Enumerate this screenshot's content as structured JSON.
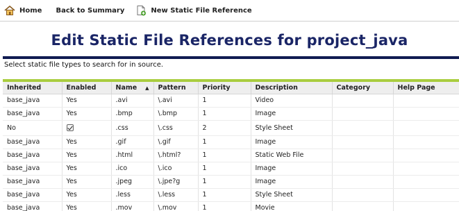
{
  "toolbar": {
    "home_label": "Home",
    "back_label": "Back to Summary",
    "new_label": "New Static File Reference"
  },
  "page": {
    "title": "Edit Static File References for project_java",
    "instructions": "Select static file types to search for in source."
  },
  "colors": {
    "title": "#1a2566",
    "title_rule": "#101c52",
    "table_accent": "#a9cd3f"
  },
  "table": {
    "headers": {
      "inherited": "Inherited",
      "enabled": "Enabled",
      "name": "Name",
      "pattern": "Pattern",
      "priority": "Priority",
      "description": "Description",
      "category": "Category",
      "help_page": "Help Page"
    },
    "sort_indicator": "▲",
    "rows": [
      {
        "inherited": "base_java",
        "enabled": "Yes",
        "name": ".avi",
        "pattern": "\\.avi",
        "priority": "1",
        "description": "Video"
      },
      {
        "inherited": "base_java",
        "enabled": "Yes",
        "name": ".bmp",
        "pattern": "\\.bmp",
        "priority": "1",
        "description": "Image"
      },
      {
        "inherited": "No",
        "enabled": "",
        "name": ".css",
        "pattern": "\\.css",
        "priority": "2",
        "description": "Style Sheet"
      },
      {
        "inherited": "base_java",
        "enabled": "Yes",
        "name": ".gif",
        "pattern": "\\.gif",
        "priority": "1",
        "description": "Image"
      },
      {
        "inherited": "base_java",
        "enabled": "Yes",
        "name": ".html",
        "pattern": "\\.html?",
        "priority": "1",
        "description": "Static Web File"
      },
      {
        "inherited": "base_java",
        "enabled": "Yes",
        "name": ".ico",
        "pattern": "\\.ico",
        "priority": "1",
        "description": "Image"
      },
      {
        "inherited": "base_java",
        "enabled": "Yes",
        "name": ".jpeg",
        "pattern": "\\.jpe?g",
        "priority": "1",
        "description": "Image"
      },
      {
        "inherited": "base_java",
        "enabled": "Yes",
        "name": ".less",
        "pattern": "\\.less",
        "priority": "1",
        "description": "Style Sheet"
      },
      {
        "inherited": "base_java",
        "enabled": "Yes",
        "name": ".mov",
        "pattern": "\\.mov",
        "priority": "1",
        "description": "Movie"
      }
    ]
  }
}
